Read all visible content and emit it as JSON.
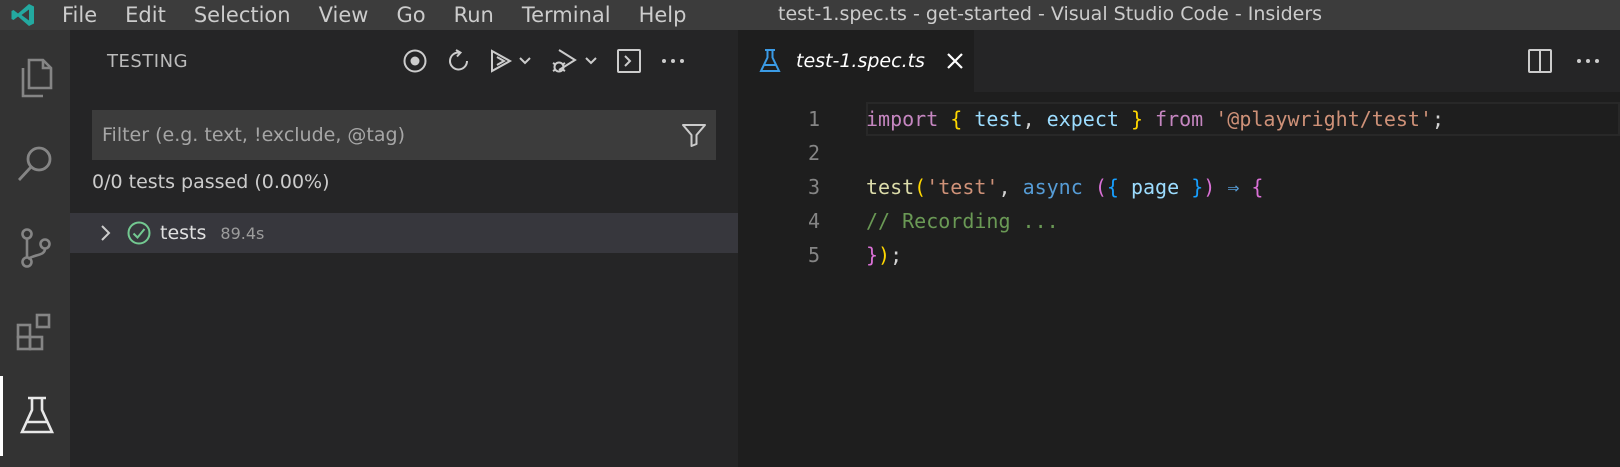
{
  "titlebar": {
    "menu": [
      "File",
      "Edit",
      "Selection",
      "View",
      "Go",
      "Run",
      "Terminal",
      "Help"
    ],
    "title": "test-1.spec.ts - get-started - Visual Studio Code - Insiders"
  },
  "activity_bar": {
    "icons": [
      "files-icon",
      "search-icon",
      "source-control-icon",
      "extensions-icon",
      "testing-flask-icon"
    ],
    "active": "testing-flask-icon"
  },
  "sidebar": {
    "title": "TESTING",
    "filter_placeholder": "Filter (e.g. text, !exclude, @tag)",
    "summary": "0/0 tests passed (0.00%)",
    "tree": [
      {
        "label": "tests",
        "duration": "89.4s",
        "status": "passed"
      }
    ]
  },
  "editor": {
    "tab_label": "test-1.spec.ts",
    "lines": [
      {
        "number": "1"
      },
      {
        "number": "2"
      },
      {
        "number": "3"
      },
      {
        "number": "4"
      },
      {
        "number": "5"
      }
    ],
    "tokens": {
      "import": "import",
      "brace_open": "{",
      "test": "test",
      "comma": ",",
      "expect": "expect",
      "brace_close": "}",
      "from": "from",
      "module": "'@playwright/test'",
      "semi": ";",
      "paren_open": "(",
      "test_name": "'test'",
      "async": "async",
      "page": "page",
      "paren_close": ")",
      "arrow": "⇒",
      "comment": "// Recording ...",
      "close_all": "})",
      "close_semi": ";"
    }
  },
  "colors": {
    "accent": "#007acc",
    "passed": "#73c991"
  }
}
